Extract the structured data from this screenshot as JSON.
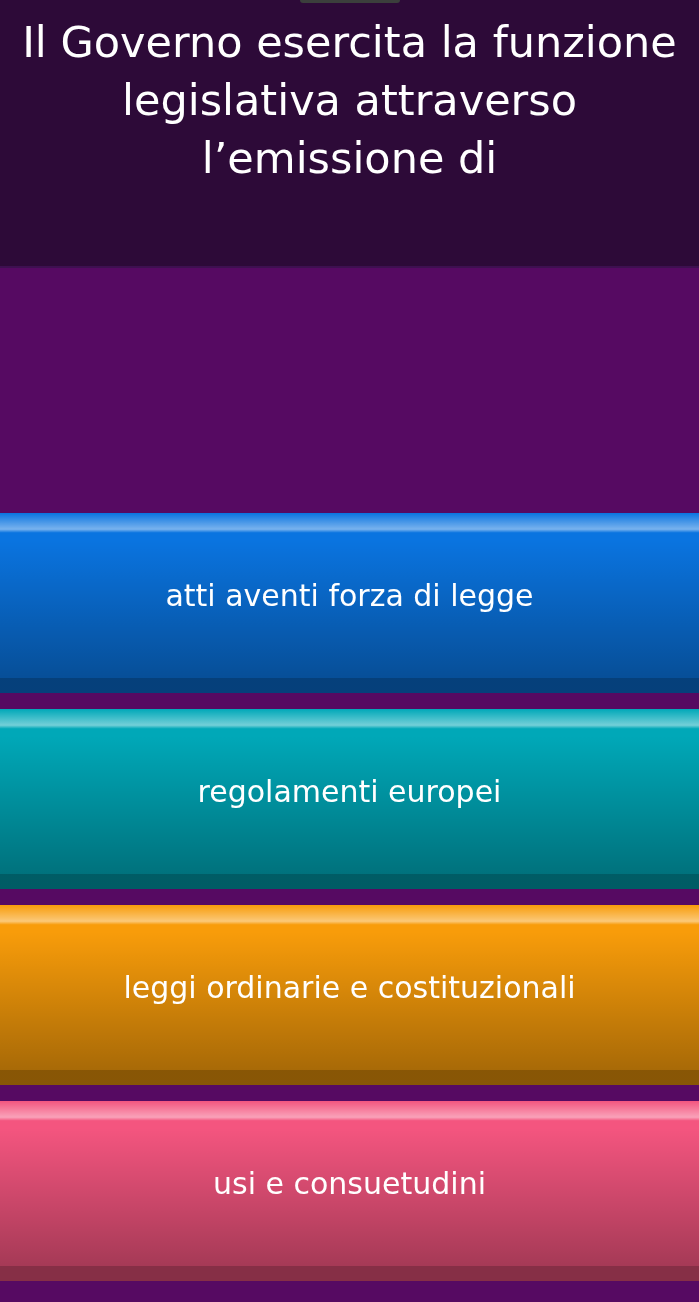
{
  "question": {
    "text": "Il Governo esercita la funzione legislativa attraverso l’emissione di"
  },
  "options": [
    {
      "label": "atti aventi forza di legge",
      "color": "#0a74e0"
    },
    {
      "label": "regolamenti europei",
      "color": "#00a8b8"
    },
    {
      "label": "leggi ordinarie e costituzionali",
      "color": "#f89c0a"
    },
    {
      "label": "usi e consuetudini",
      "color": "#f4557f"
    }
  ]
}
